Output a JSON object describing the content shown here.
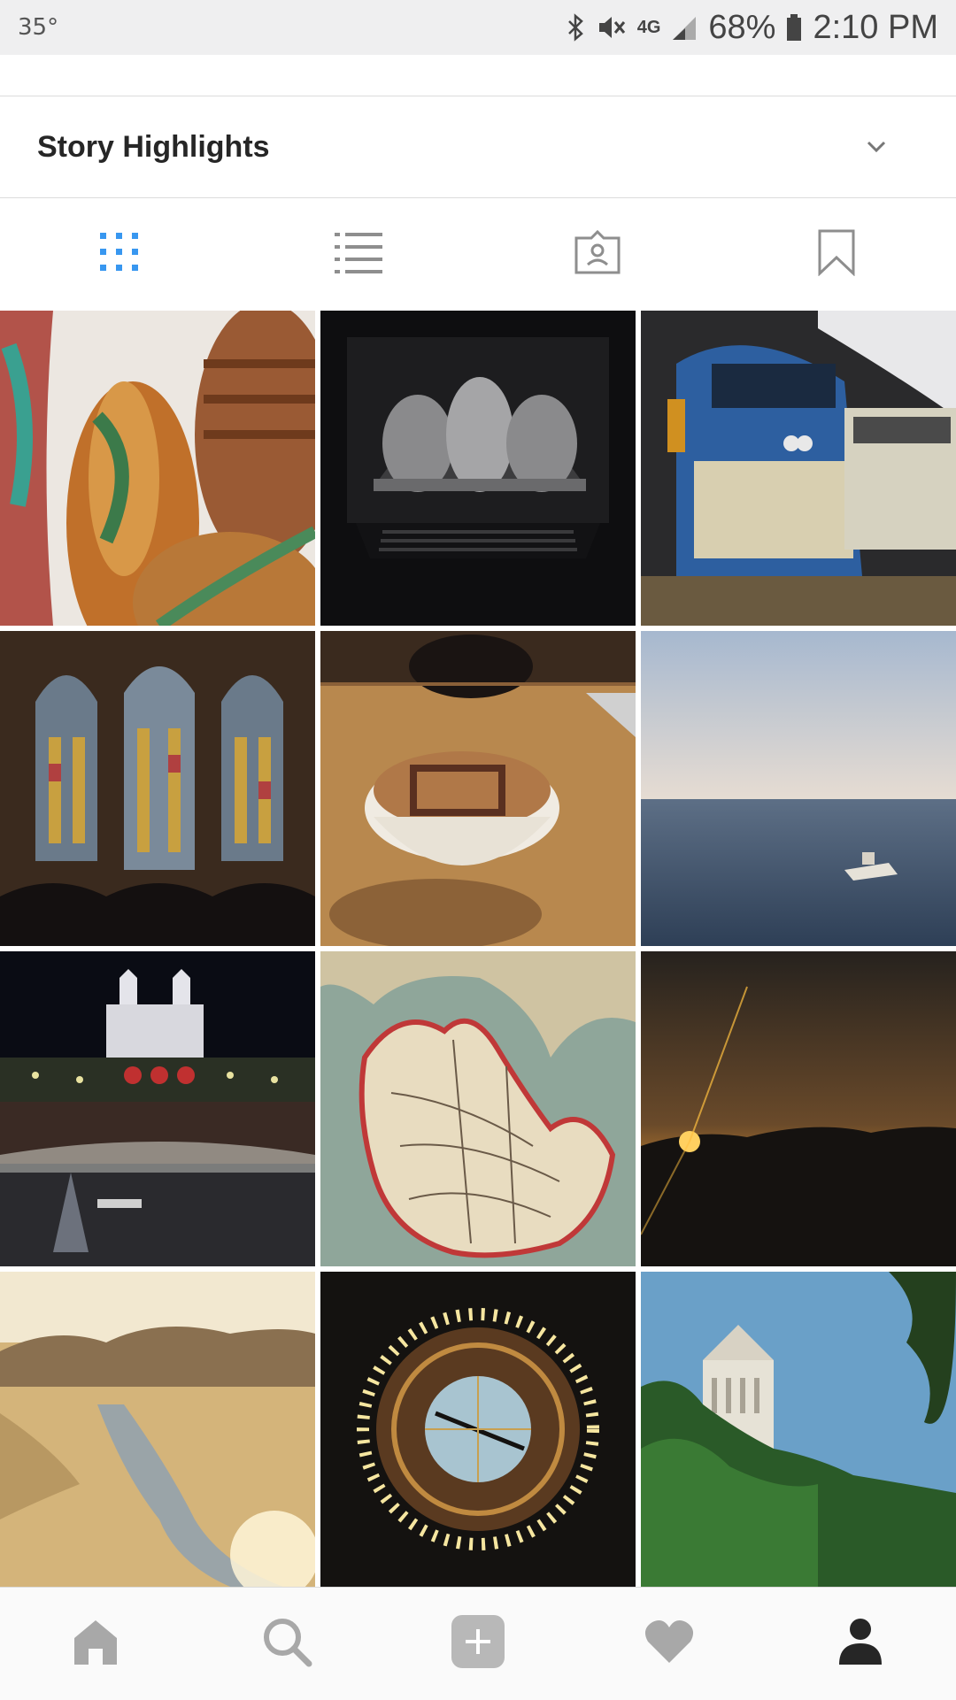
{
  "status_bar": {
    "temperature": "35°",
    "network": "4G",
    "battery": "68%",
    "time": "2:10 PM"
  },
  "highlights": {
    "title": "Story Highlights"
  },
  "tabs": [
    {
      "icon": "grid-icon",
      "active": true
    },
    {
      "icon": "list-icon",
      "active": false
    },
    {
      "icon": "tagged-icon",
      "active": false
    },
    {
      "icon": "bookmark-icon",
      "active": false
    }
  ],
  "photos": [
    {
      "subject": "wooden vases"
    },
    {
      "subject": "laptop with sculpture"
    },
    {
      "subject": "train locomotive"
    },
    {
      "subject": "cathedral stained glass"
    },
    {
      "subject": "latte art"
    },
    {
      "subject": "ocean with boat"
    },
    {
      "subject": "square at night"
    },
    {
      "subject": "old map of michigan"
    },
    {
      "subject": "sunset over hills"
    },
    {
      "subject": "river valley"
    },
    {
      "subject": "illuminated ceiling clock"
    },
    {
      "subject": "tower and trees"
    }
  ],
  "bottom_nav": [
    {
      "icon": "home-icon"
    },
    {
      "icon": "search-icon"
    },
    {
      "icon": "add-icon"
    },
    {
      "icon": "heart-icon"
    },
    {
      "icon": "profile-icon",
      "active": true
    }
  ],
  "colors": {
    "accent": "#3897f0",
    "icon_inactive": "#8e8e8e",
    "text": "#262626"
  }
}
